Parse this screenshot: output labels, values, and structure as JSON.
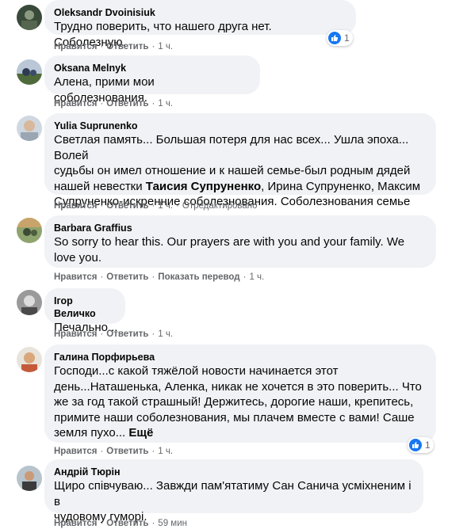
{
  "comments": [
    {
      "author": "Oleksandr Dvoinisiuk",
      "text": "Трудно поверить, что нашего друга нет. Соболезную.",
      "like": "Нравится",
      "reply": "Ответить",
      "time": "1 ч.",
      "reactions": "1"
    },
    {
      "author": "Oksana Melnyk",
      "text": "Алена, прими мои соболезнования.",
      "like": "Нравится",
      "reply": "Ответить",
      "time": "1 ч."
    },
    {
      "author": "Yulia Suprunenko",
      "text_lines": [
        "Светлая память... Большая потеря для нас всех... Ушла эпоха... Волей",
        "судьбы он имел отношение и к нашей семье-был родным дядей",
        "нашей невестки ",
        ", Ирина Супруненко, Максим",
        "Супруненко-искренние соболезнования. Соболезнования семье"
      ],
      "mention": "Таисия Супруненко",
      "like": "Нравится",
      "reply": "Ответить",
      "time": "1 ч.",
      "edited": "Отредактировано"
    },
    {
      "author": "Barbara Graffius",
      "text_lines": [
        "So sorry to hear this. Our prayers are with you and your family. We",
        "love you."
      ],
      "like": "Нравится",
      "reply": "Ответить",
      "translate": "Показать перевод",
      "time": "1 ч."
    },
    {
      "author": "Ігор Величко",
      "text": "Печально...",
      "like": "Нравится",
      "reply": "Ответить",
      "time": "1 ч."
    },
    {
      "author": "Галина Порфирьева",
      "text_lines": [
        "Господи...с какой тяжёлой новости начинается этот",
        "день...Наташенька, Аленка, никак не хочется в это поверить... Что",
        "же за год такой страшный! Держитесь, дорогие наши, крепитесь,",
        "примите наши соболезнования, мы плачем вместе с вами! Саше",
        "земля пухо... "
      ],
      "more": "Ещё",
      "like": "Нравится",
      "reply": "Ответить",
      "time": "1 ч.",
      "reactions": "1"
    },
    {
      "author": "Андрій Тюрін",
      "text_lines": [
        "Щиро співчуваю... Завжди пам'ятатиму Сан Санича усміхненим і в",
        "чудовому гуморі."
      ],
      "like": "Нравится",
      "reply": "Ответить",
      "time": "59 мин"
    }
  ],
  "sep": "·",
  "colors": {
    "bubble": "#f0f2f5",
    "meta": "#65676b",
    "like": "#1877f2"
  }
}
